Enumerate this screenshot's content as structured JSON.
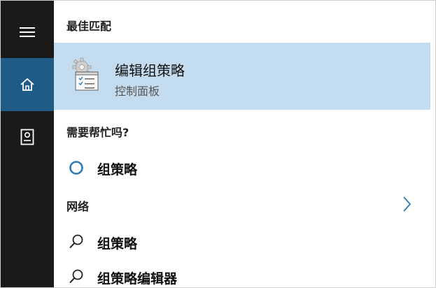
{
  "sidebar": {
    "items": [
      {
        "name": "menu",
        "icon": "hamburger-icon"
      },
      {
        "name": "home",
        "icon": "home-icon",
        "active": true
      },
      {
        "name": "notebook",
        "icon": "notebook-icon"
      }
    ],
    "bg_color": "#1a1a1a",
    "active_color": "#1e5b86"
  },
  "sections": {
    "best_match_title": "最佳匹配",
    "help_title": "需要帮忙吗?",
    "network_title": "网络"
  },
  "best_match": {
    "title": "编辑组策略",
    "subtitle": "控制面板",
    "icon": "group-policy-icon",
    "highlight_color": "#c4dcef"
  },
  "help_items": [
    {
      "label": "组策略",
      "icon": "cortana-circle-icon"
    }
  ],
  "network_items": [
    {
      "label": "组策略",
      "icon": "search-icon"
    },
    {
      "label": "组策略编辑器",
      "icon": "search-icon"
    }
  ]
}
